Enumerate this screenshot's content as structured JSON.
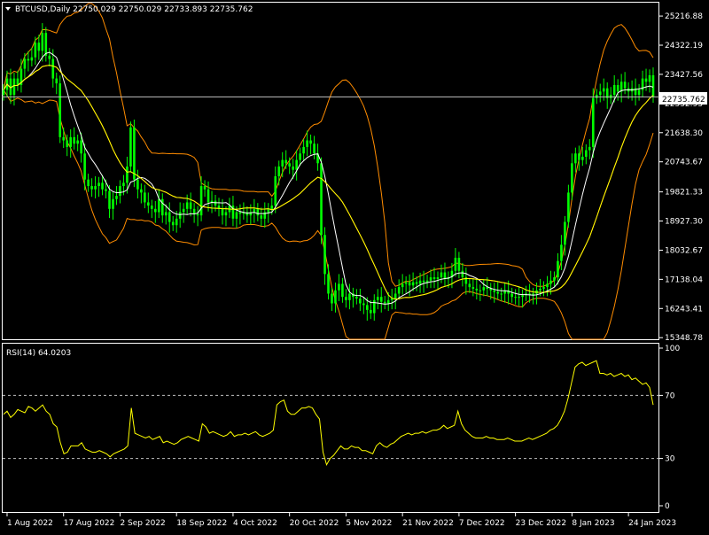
{
  "symbol_header": "BTCUSD,Daily  22750.029 22750.029 22733.893 22735.762",
  "current_price_label": "22735.762",
  "rsi_header": "RSI(14) 64.0203",
  "colors": {
    "background": "#000000",
    "bull_candle": "#00ff00",
    "bollinger": "#ff8c00",
    "moving_average_fast": "#ffffff",
    "moving_average_slow": "#ffff00",
    "rsi_line": "#ffff00",
    "axis_text": "#ffffff",
    "frame": "#ffffff"
  },
  "icons": {
    "menu": "triangle-down-icon"
  },
  "chart_data": [
    {
      "type": "candlestick",
      "title": "BTCUSD,Daily",
      "ohlc_last": {
        "open": 22750.029,
        "high": 22750.029,
        "low": 22733.893,
        "close": 22735.762
      },
      "y_ticks": [
        25216.88,
        24322.19,
        23427.56,
        22532.93,
        21638.3,
        20743.67,
        19821.33,
        18927.3,
        18032.67,
        17138.04,
        16243.41,
        15348.78
      ],
      "ylim": [
        15300,
        25600
      ],
      "x_tick_labels": [
        "1 Aug 2022",
        "17 Aug 2022",
        "2 Sep 2022",
        "18 Sep 2022",
        "4 Oct 2022",
        "20 Oct 2022",
        "5 Nov 2022",
        "21 Nov 2022",
        "7 Dec 2022",
        "23 Dec 2022",
        "8 Jan 2023",
        "24 Jan 2023"
      ],
      "x_tick_indices": [
        1,
        17,
        33,
        49,
        65,
        81,
        97,
        113,
        129,
        145,
        161,
        177
      ],
      "close_series": [
        22950,
        23300,
        22800,
        23300,
        23100,
        23600,
        23900,
        23850,
        23950,
        24400,
        24150,
        24700,
        24000,
        23900,
        23300,
        23150,
        21500,
        21400,
        21200,
        21500,
        21300,
        21400,
        21000,
        20200,
        20000,
        19900,
        20000,
        20100,
        19900,
        19850,
        19300,
        19600,
        19700,
        20000,
        20100,
        20600,
        21800,
        20200,
        19900,
        19800,
        19500,
        19400,
        19300,
        19200,
        19600,
        19100,
        19200,
        18900,
        18800,
        19000,
        19200,
        19300,
        19500,
        19300,
        19150,
        19100,
        20000,
        19900,
        19500,
        19550,
        19400,
        19300,
        19100,
        19200,
        19400,
        19000,
        19200,
        19150,
        19200,
        19100,
        19200,
        19300,
        19100,
        19000,
        19200,
        19300,
        19400,
        20300,
        20600,
        20800,
        20700,
        20600,
        20500,
        20800,
        21000,
        21200,
        21400,
        21300,
        21000,
        20700,
        18500,
        17300,
        16700,
        16400,
        16800,
        17000,
        16600,
        16500,
        16700,
        16600,
        16550,
        16400,
        16350,
        16200,
        16100,
        16500,
        16600,
        16450,
        16400,
        16500,
        16550,
        16700,
        16900,
        17000,
        17050,
        16950,
        17050,
        17000,
        17100,
        17050,
        17100,
        17200,
        17150,
        17200,
        17350,
        17150,
        17200,
        17400,
        17800,
        17400,
        17200,
        17000,
        16900,
        16850,
        16800,
        16800,
        16900,
        16850,
        16800,
        16750,
        16700,
        16700,
        16800,
        16700,
        16600,
        16600,
        16600,
        16650,
        16700,
        16650,
        16700,
        16800,
        16850,
        16900,
        17000,
        17100,
        17200,
        17700,
        18200,
        18900,
        19800,
        20700,
        21000,
        20800,
        20900,
        21100,
        21200,
        22700,
        22800,
        22900,
        23000,
        22700,
        22800,
        23100,
        22900,
        23200,
        23000,
        22900,
        23000,
        22800,
        22950,
        23300,
        23200,
        23400,
        22736
      ]
    },
    {
      "type": "line",
      "title": "RSI(14) 64.0203",
      "y_ticks": [
        100,
        70,
        30,
        0
      ],
      "ylim": [
        0,
        100
      ],
      "levels": [
        70,
        30
      ],
      "last_value": 64.0203,
      "values": [
        58,
        60,
        56,
        58,
        61,
        60,
        59,
        63,
        62,
        60,
        62,
        64,
        60,
        58,
        52,
        50,
        40,
        33,
        34,
        38,
        38,
        38,
        40,
        36,
        35,
        34,
        34,
        35,
        34,
        33,
        31,
        33,
        34,
        35,
        36,
        38,
        62,
        46,
        45,
        44,
        43,
        44,
        42,
        43,
        44,
        40,
        41,
        40,
        39,
        40,
        42,
        43,
        44,
        43,
        42,
        41,
        52,
        50,
        46,
        47,
        46,
        45,
        44,
        45,
        47,
        44,
        45,
        45,
        46,
        45,
        46,
        47,
        45,
        44,
        45,
        46,
        48,
        64,
        66,
        67,
        60,
        58,
        58,
        60,
        62,
        62,
        63,
        62,
        58,
        55,
        34,
        26,
        30,
        32,
        35,
        38,
        36,
        36,
        38,
        37,
        37,
        35,
        35,
        34,
        33,
        38,
        40,
        38,
        37,
        39,
        40,
        42,
        44,
        45,
        46,
        45,
        46,
        46,
        47,
        46,
        47,
        48,
        48,
        49,
        51,
        49,
        50,
        51,
        60,
        52,
        48,
        46,
        44,
        43,
        43,
        43,
        44,
        43,
        43,
        42,
        42,
        42,
        43,
        42,
        41,
        41,
        41,
        42,
        43,
        42,
        43,
        44,
        45,
        46,
        48,
        49,
        51,
        55,
        60,
        68,
        78,
        88,
        90,
        91,
        89,
        90,
        91,
        92,
        84,
        84,
        83,
        84,
        82,
        83,
        84,
        82,
        83,
        80,
        81,
        79,
        77,
        78,
        75,
        64
      ]
    }
  ]
}
